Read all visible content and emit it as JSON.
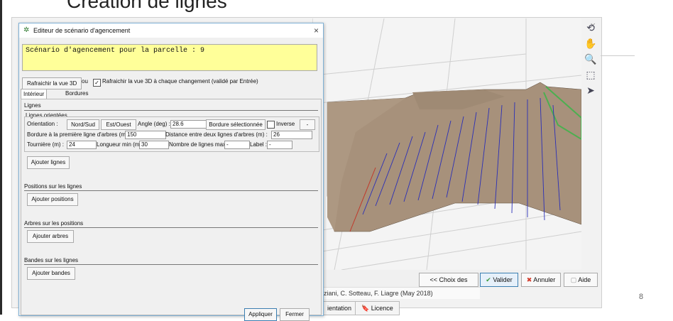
{
  "slide": {
    "title": "Création de lignes",
    "page_number": "8"
  },
  "window3d": {
    "close_glyph": "×",
    "buttons": {
      "choix": "<< Choix des fichiers",
      "valider": "Valider",
      "annuler": "Annuler",
      "aide": "Aide"
    },
    "credit": "ziani, C. Sotteau, F. Liagre (May 2018)",
    "tabs": [
      "ientation",
      "Licence"
    ],
    "toolbar_icons": [
      "rotate-icon",
      "pan-hand-icon",
      "zoom-icon",
      "zoom-region-icon",
      "pointer-icon",
      "grid-icon"
    ],
    "colors": {
      "ground": "#a7917b",
      "blue_lines": "#2a2fb8",
      "red_line": "#c0392b",
      "green_border": "#4caf50"
    }
  },
  "dialog": {
    "title": "Editeur de scénario d'agencement",
    "close_glyph": "×",
    "scenario_text": "Scénario d'agencement pour la parcelle : 9",
    "refresh_button": "Rafraichir la vue 3D",
    "ou_label": "ou",
    "auto_refresh_label": "Rafraichir la vue 3D à chaque changement (validé par Entrée)",
    "auto_refresh_checked": true,
    "tabs": [
      "Intérieur parcelle",
      "Bordures"
    ],
    "sections": {
      "lignes": {
        "title": "Lignes",
        "group_title": "Lignes orientées",
        "orientation_label": "Orientation :",
        "btn_nord_sud": "Nord/Sud",
        "btn_est_ouest": "Est/Ouest",
        "angle_label": "Angle (deg) :",
        "angle_value": "28.6",
        "btn_bordure": "Bordure sélectionnée",
        "inverse_label": "Inverse",
        "inverse_checked": false,
        "dash_button": "-",
        "bordure_label": "Bordure à la première ligne d'arbres (m) :",
        "bordure_value": "150",
        "distance_label": "Distance entre deux lignes d'arbres (m) :",
        "distance_value": "26",
        "tourniere_label": "Tournière (m) :",
        "tourniere_value": "24",
        "longueur_label": "Longueur min (m) :",
        "longueur_value": "30",
        "nombre_label": "Nombre de lignes max :",
        "nombre_value": "-",
        "label_label": "Label :",
        "label_value": "-",
        "add_button": "Ajouter lignes"
      },
      "positions": {
        "title": "Positions sur les lignes",
        "add_button": "Ajouter positions"
      },
      "arbres": {
        "title": "Arbres sur les positions",
        "add_button": "Ajouter arbres"
      },
      "bandes": {
        "title": "Bandes sur les lignes",
        "add_button": "Ajouter bandes"
      }
    },
    "footer": {
      "appliquer": "Appliquer",
      "fermer": "Fermer"
    }
  }
}
